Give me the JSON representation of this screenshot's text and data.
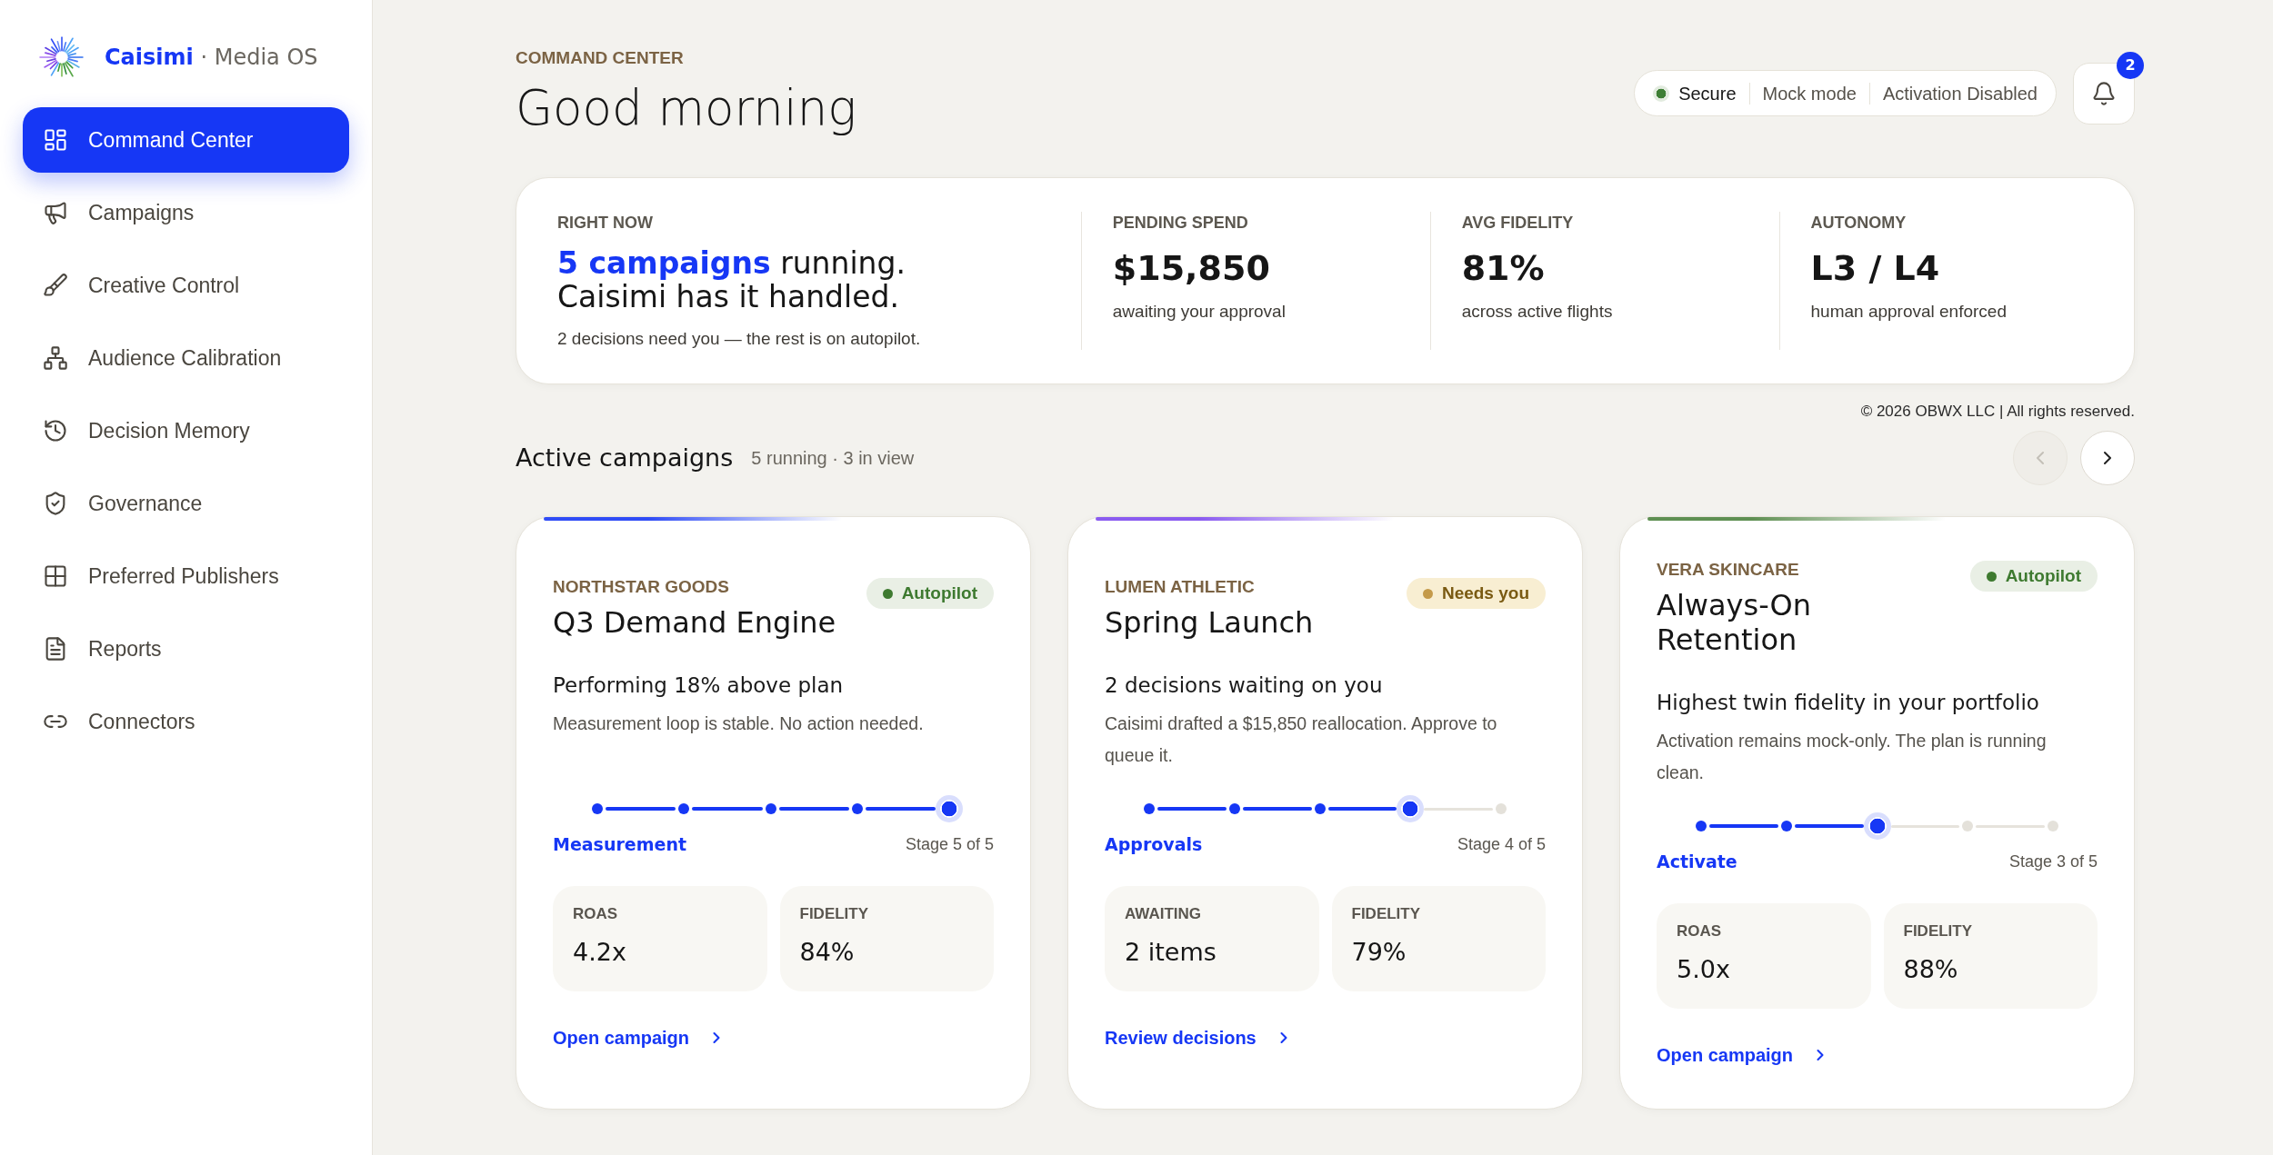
{
  "sidebar": {
    "brand": "**Caisimi** · Media OS",
    "items": [
      {
        "label": "Command Center",
        "selected": true
      },
      {
        "label": "Campaigns",
        "selected": false
      },
      {
        "label": "Creative Control",
        "selected": false
      },
      {
        "label": "Audience Calibration",
        "selected": false
      },
      {
        "label": "Decision Memory",
        "selected": false
      },
      {
        "label": "Governance",
        "selected": false
      },
      {
        "label": "Preferred Publishers",
        "selected": false
      },
      {
        "label": "Reports",
        "selected": false
      },
      {
        "label": "Connectors",
        "selected": false
      }
    ]
  },
  "header": {
    "eyebrow": "COMMAND CENTER",
    "title": "Good morning",
    "status": [
      {
        "label": "Secure",
        "kind": "indicator"
      },
      {
        "label": "Mock mode",
        "kind": "plain"
      },
      {
        "label": "Activation Disabled",
        "kind": "plain"
      }
    ],
    "notifications": {
      "count": "2"
    }
  },
  "right_now": {
    "label": "RIGHT NOW",
    "headline": "**5 campaigns** running.\nCaisimi has it handled.",
    "note": "2 decisions need you — the rest is on autopilot.",
    "stats": [
      {
        "label": "PENDING SPEND",
        "value": "$15,850",
        "note": "awaiting your approval"
      },
      {
        "label": "AVG FIDELITY",
        "value": "81%",
        "note": "across active flights"
      },
      {
        "label": "AUTONOMY",
        "value": "L3 / L4",
        "note": "human approval enforced"
      }
    ]
  },
  "copyright": "© 2026 OBWX LLC | All rights reserved.",
  "section": {
    "title": "Active campaigns",
    "summary": "5 running · 3 in view",
    "prev": {
      "disabled": true
    },
    "next": {
      "disabled": false
    }
  },
  "campaigns": [
    {
      "color": "#2f4cf6",
      "brand": "NORTHSTAR GOODS",
      "badge": {
        "kind": "autopilot",
        "label": "Autopilot"
      },
      "name": "Q3 Demand Engine",
      "headline": "Performing 18% above plan",
      "detail": "Measurement loop is stable. No action needed.",
      "steps": [
        {
          "reached": true,
          "current": false
        },
        {
          "reached": true,
          "current": false
        },
        {
          "reached": true,
          "current": false
        },
        {
          "reached": true,
          "current": false
        },
        {
          "reached": true,
          "current": true
        }
      ],
      "stage": "Measurement",
      "stage_count": "Stage 5 of 5",
      "metrics": [
        {
          "label": "ROAS",
          "value": "4.2x"
        },
        {
          "label": "FIDELITY",
          "value": "84%"
        }
      ],
      "action": "Open campaign"
    },
    {
      "color": "#8a5cf0",
      "brand": "LUMEN ATHLETIC",
      "badge": {
        "kind": "attention",
        "label": "Needs you"
      },
      "name": "Spring Launch",
      "headline": "2 decisions waiting on you",
      "detail": "Caisimi drafted a $15,850 reallocation. Approve to queue it.",
      "steps": [
        {
          "reached": true,
          "current": false
        },
        {
          "reached": true,
          "current": false
        },
        {
          "reached": true,
          "current": false
        },
        {
          "reached": true,
          "current": true
        },
        {
          "reached": false,
          "current": false
        }
      ],
      "stage": "Approvals",
      "stage_count": "Stage 4 of 5",
      "metrics": [
        {
          "label": "AWAITING",
          "value": "2 items"
        },
        {
          "label": "FIDELITY",
          "value": "79%"
        }
      ],
      "action": "Review decisions"
    },
    {
      "color": "#5e8f52",
      "brand": "VERA SKINCARE",
      "badge": {
        "kind": "autopilot",
        "label": "Autopilot"
      },
      "name": "Always-On Retention",
      "headline": "Highest twin fidelity in your portfolio",
      "detail": "Activation remains mock-only. The plan is running clean.",
      "steps": [
        {
          "reached": true,
          "current": false
        },
        {
          "reached": true,
          "current": false
        },
        {
          "reached": true,
          "current": true
        },
        {
          "reached": false,
          "current": false
        },
        {
          "reached": false,
          "current": false
        }
      ],
      "stage": "Activate",
      "stage_count": "Stage 3 of 5",
      "metrics": [
        {
          "label": "ROAS",
          "value": "5.0x"
        },
        {
          "label": "FIDELITY",
          "value": "88%"
        }
      ],
      "action": "Open campaign"
    }
  ]
}
